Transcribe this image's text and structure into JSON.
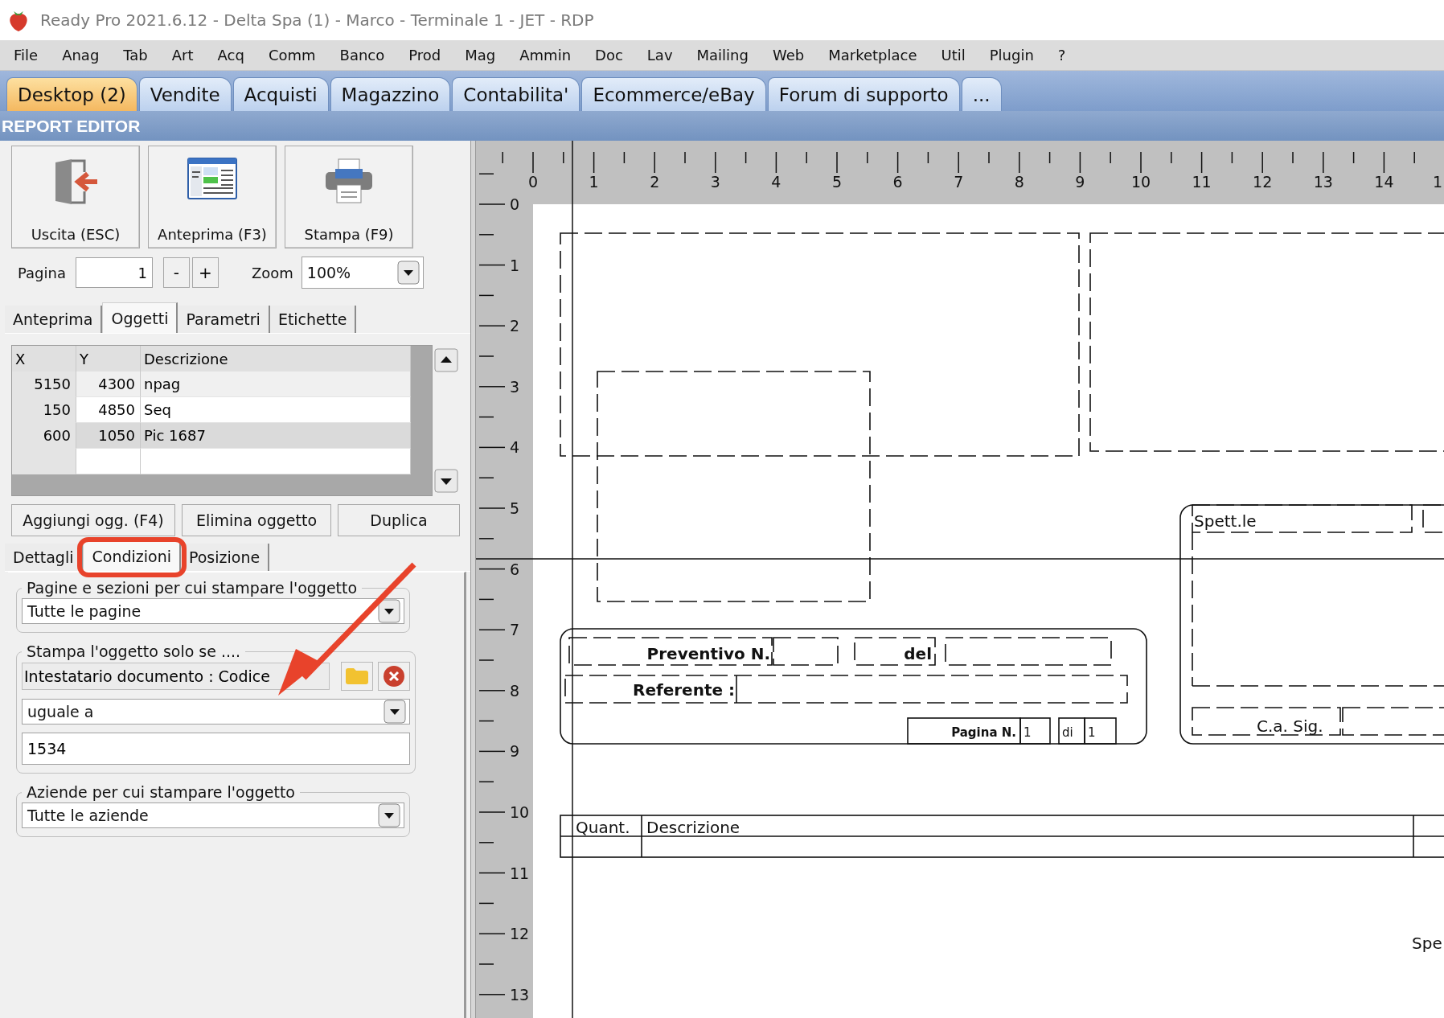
{
  "window": {
    "title": "Ready Pro 2021.6.12 - Delta Spa (1) - Marco - Terminale 1 - JET - RDP"
  },
  "menu": [
    "File",
    "Anag",
    "Tab",
    "Art",
    "Acq",
    "Comm",
    "Banco",
    "Prod",
    "Mag",
    "Ammin",
    "Doc",
    "Lav",
    "Mailing",
    "Web",
    "Marketplace",
    "Util",
    "Plugin",
    "?"
  ],
  "tabs": [
    {
      "label": "Desktop (2)",
      "selected": true
    },
    {
      "label": "Vendite",
      "selected": false
    },
    {
      "label": "Acquisti",
      "selected": false
    },
    {
      "label": "Magazzino",
      "selected": false
    },
    {
      "label": "Contabilita'",
      "selected": false
    },
    {
      "label": "Ecommerce/eBay",
      "selected": false
    },
    {
      "label": "Forum di supporto",
      "selected": false
    },
    {
      "label": "...",
      "selected": false
    }
  ],
  "panel_title": "REPORT EDITOR",
  "toolbar": [
    {
      "kind": "exit",
      "label": "Uscita (ESC)"
    },
    {
      "kind": "preview",
      "label": "Anteprima (F3)"
    },
    {
      "kind": "print",
      "label": "Stampa (F9)"
    }
  ],
  "pager": {
    "label": "Pagina",
    "value": "1",
    "minus": "-",
    "plus": "+",
    "zoom_label": "Zoom",
    "zoom_value": "100%"
  },
  "editor_tabs": [
    {
      "label": "Anteprima",
      "selected": false
    },
    {
      "label": "Oggetti",
      "selected": true
    },
    {
      "label": "Parametri",
      "selected": false
    },
    {
      "label": "Etichette",
      "selected": false
    }
  ],
  "objects_table": {
    "columns": [
      "X",
      "Y",
      "Descrizione"
    ],
    "rows": [
      {
        "cells": [
          "5150",
          "4300",
          "npag"
        ],
        "selected": false
      },
      {
        "cells": [
          "150",
          "4850",
          "Seq"
        ],
        "selected": false
      },
      {
        "cells": [
          "600",
          "1050",
          "Pic 1687"
        ],
        "selected": true
      }
    ]
  },
  "object_buttons": [
    "Aggiungi ogg. (F4)",
    "Elimina oggetto",
    "Duplica"
  ],
  "detail_tabs": [
    {
      "label": "Dettagli",
      "selected": false
    },
    {
      "label": "Condizioni",
      "selected": true
    },
    {
      "label": "Posizione",
      "selected": false
    }
  ],
  "conditions": {
    "pages_group": {
      "legend": "Pagine e sezioni per cui stampare l'oggetto",
      "value": "Tutte le pagine"
    },
    "print_if_group": {
      "legend": "Stampa l'oggetto solo se ....",
      "field": "Intestatario documento : Codice",
      "operator": "uguale a",
      "value": "1534"
    },
    "companies_group": {
      "legend": "Aziende per cui stampare l'oggetto",
      "value": "Tutte le aziende"
    }
  },
  "ruler": {
    "x_labels": [
      "0",
      "1",
      "2",
      "3",
      "4",
      "5",
      "6",
      "7",
      "8",
      "9",
      "10",
      "11",
      "12",
      "13",
      "14",
      "1"
    ],
    "y_labels": [
      "0",
      "1",
      "2",
      "3",
      "4",
      "5",
      "6",
      "7",
      "8",
      "9",
      "10",
      "11",
      "12",
      "13"
    ]
  },
  "report": {
    "texts": [
      {
        "kind": "bold",
        "text": "Preventivo N."
      },
      {
        "kind": "bold",
        "text": "del"
      },
      {
        "kind": "bold",
        "text": "Referente :"
      },
      {
        "kind": "small_bold",
        "text": "Pagina N."
      },
      {
        "kind": "small",
        "text": "1"
      },
      {
        "kind": "small",
        "text": "di"
      },
      {
        "kind": "small",
        "text": "1"
      },
      {
        "kind": "plain",
        "text": "Spett.le"
      },
      {
        "kind": "plain",
        "text": "C.a. Sig."
      },
      {
        "kind": "plain",
        "text": "Quant."
      },
      {
        "kind": "plain",
        "text": "Descrizione"
      },
      {
        "kind": "plain",
        "text": "Spe"
      }
    ]
  }
}
